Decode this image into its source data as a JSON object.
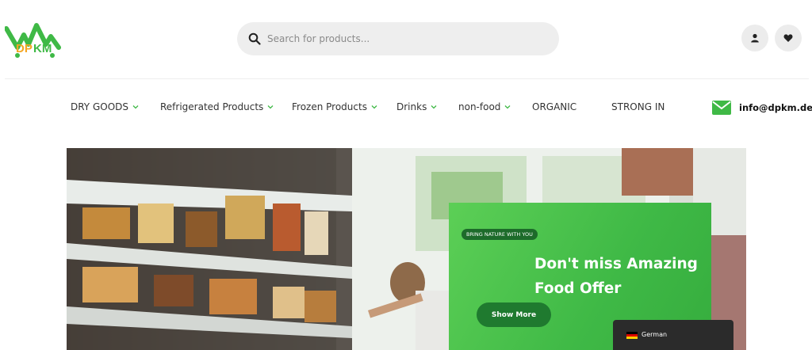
{
  "brand": {
    "logo_text": "DPKM",
    "accent": "#3fb946",
    "logo_orange": "#f5a623"
  },
  "search": {
    "placeholder": "Search for products..."
  },
  "header": {
    "icons": [
      "user-icon",
      "heart-icon"
    ]
  },
  "nav": {
    "items": [
      {
        "label": "DRY GOODS",
        "dropdown": true
      },
      {
        "label": "Refrigerated Products",
        "dropdown": true
      },
      {
        "label": "Frozen Products",
        "dropdown": true
      },
      {
        "label": "Drinks",
        "dropdown": true
      },
      {
        "label": "non-food",
        "dropdown": true
      },
      {
        "label": "ORGANIC",
        "dropdown": false
      },
      {
        "label": "STRONG IN",
        "dropdown": false
      }
    ]
  },
  "contact": {
    "email": "info@dpkm.de"
  },
  "hero": {
    "badge": "BRING NATURE WITH YOU",
    "headline_line1": "Don't miss Amazing",
    "headline_line2": "Food Offer",
    "cta": "Show More"
  },
  "language": {
    "label": "German"
  }
}
